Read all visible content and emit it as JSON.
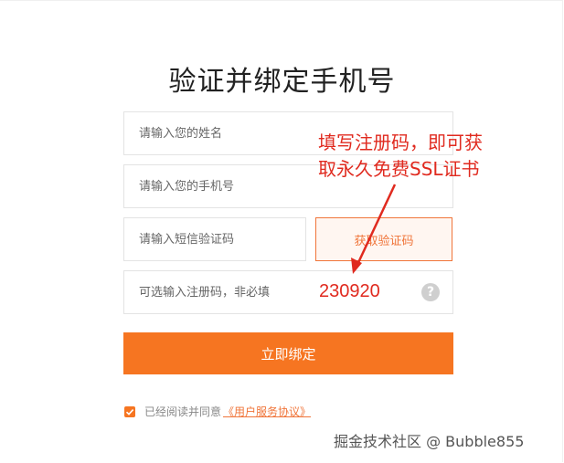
{
  "page": {
    "title": "验证并绑定手机号"
  },
  "form": {
    "name_placeholder": "请输入您的姓名",
    "phone_placeholder": "请输入您的手机号",
    "sms_placeholder": "请输入短信验证码",
    "get_code_label": "获取验证码",
    "reg_placeholder": "可选输入注册码，非必填",
    "reg_value": "230920",
    "help_icon": "question-circle-icon",
    "submit_label": "立即绑定",
    "agree_text": "已经阅读并同意",
    "agree_link": "《用户服务协议》",
    "agree_checked": true
  },
  "annotation": {
    "line1": "填写注册码，即可获",
    "line2": "取永久免费SSL证书",
    "color": "#e02a1f"
  },
  "watermark": {
    "text": "掘金技术社区 @ Bubble855"
  },
  "colors": {
    "accent": "#f67521",
    "annotation_red": "#e02a1f"
  }
}
